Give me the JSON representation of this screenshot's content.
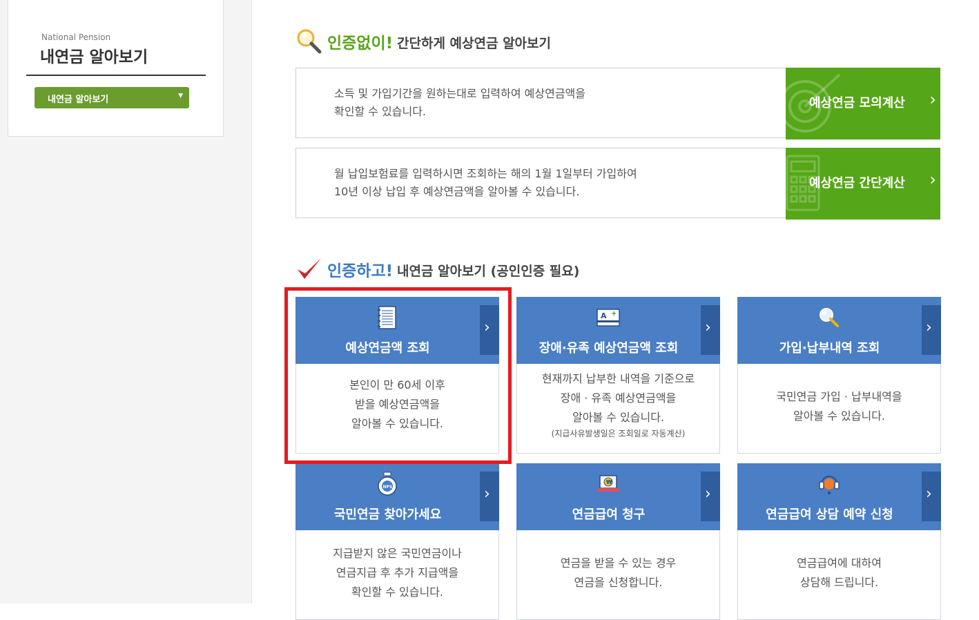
{
  "sidebar": {
    "subtitle": "National Pension",
    "title": "내연금 알아보기",
    "select_label": "내연금 알아보기"
  },
  "section_no_auth": {
    "highlight": "인증없이!",
    "rest": "간단하게 예상연금 알아보기"
  },
  "calculators": [
    {
      "desc_line1": "소득 및 가입기간을 원하는대로 입력하여 예상연금액을",
      "desc_line2": "확인할 수 있습니다.",
      "button": "예상연금 모의계산"
    },
    {
      "desc_line1": "월 납입보험료를 입력하시면 조회하는 해의 1월 1일부터 가입하여",
      "desc_line2": "10년 이상 납입 후 예상연금액을 알아볼 수 있습니다.",
      "button": "예상연금 간단계산"
    }
  ],
  "section_auth": {
    "highlight": "인증하고!",
    "rest": "내연금 알아보기 (공인인증 필요)"
  },
  "cards": [
    {
      "title": "예상연금액 조회",
      "icon": "document-list-icon",
      "lines": [
        "본인이 만 60세 이후",
        "받을 예상연금액을",
        "알아볼 수 있습니다."
      ],
      "note": ""
    },
    {
      "title": "장애·유족 예상연금액 조회",
      "icon": "id-card-icon",
      "lines": [
        "현재까지 납부한 내역을 기준으로",
        "장애 · 유족 예상연금액을",
        "알아볼 수 있습니다."
      ],
      "note": "(지급사유발생일은 조회일로 자동계산)"
    },
    {
      "title": "가입·납부내역 조회",
      "icon": "magnifier-icon",
      "lines": [
        "국민연금 가입 · 납부내역을",
        "알아볼 수 있습니다."
      ],
      "note": ""
    },
    {
      "title": "국민연금 찾아가세요",
      "icon": "nps-pouch-icon",
      "lines": [
        "지급받지 않은 국민연금이나",
        "연금지급 후 추가 지급액을",
        "확인할 수 있습니다."
      ],
      "note": ""
    },
    {
      "title": "연금급여 청구",
      "icon": "laptop-coin-icon",
      "lines": [
        "연금을 받을 수 있는 경우",
        "연금을 신청합니다."
      ],
      "note": ""
    },
    {
      "title": "연금급여 상담 예약 신청",
      "icon": "headset-icon",
      "lines": [
        "연금급여에 대하여",
        "상담해 드립니다."
      ],
      "note": ""
    }
  ],
  "colors": {
    "green_text": "#5aa51c",
    "green_button": "#55a618",
    "blue_text": "#3a7bc8",
    "card_blue": "#4a7ec5",
    "highlight_red": "#e31c22"
  }
}
